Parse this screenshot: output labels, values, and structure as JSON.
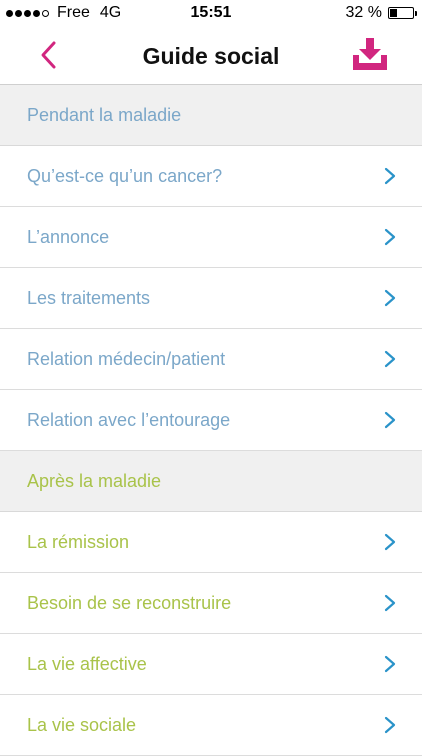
{
  "status_bar": {
    "carrier": "Free",
    "network": "4G",
    "time": "15:51",
    "battery_percent": "32 %",
    "battery_level": 0.32
  },
  "nav": {
    "title": "Guide social",
    "back_icon": "chevron-left-icon",
    "download_icon": "download-tray-icon",
    "accent_color": "#d1267f"
  },
  "sections": [
    {
      "header": "Pendant la maladie",
      "color": "#7ba7c9",
      "items": [
        "Qu’est-ce qu’un cancer?",
        "L’annonce",
        "Les traitements",
        "Relation médecin/patient",
        "Relation avec l’entourage"
      ]
    },
    {
      "header": "Après la maladie",
      "color": "#a9c34a",
      "items": [
        "La rémission",
        "Besoin de se reconstruire",
        "La vie affective",
        "La vie sociale"
      ]
    }
  ],
  "chevron_color": "#2a93c9"
}
